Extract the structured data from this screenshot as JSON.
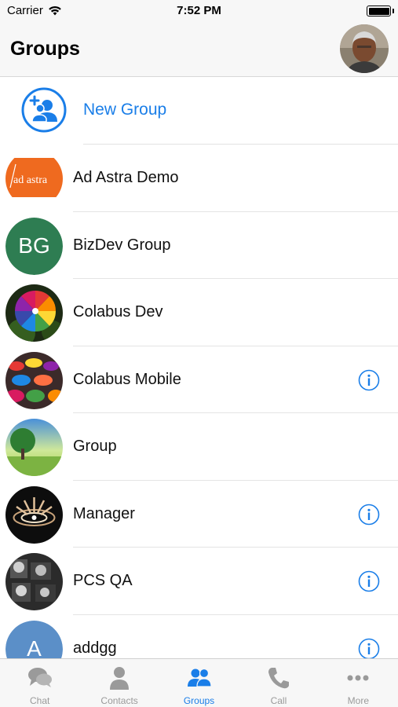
{
  "status_bar": {
    "carrier": "Carrier",
    "time": "7:52 PM"
  },
  "header": {
    "title": "Groups"
  },
  "new_group": {
    "label": "New Group"
  },
  "groups": [
    {
      "name": "Ad Astra Demo",
      "logo_text": "ad astra",
      "info": false
    },
    {
      "name": "BizDev Group",
      "initials": "BG",
      "color": "#2e7d52",
      "info": false
    },
    {
      "name": "Colabus Dev",
      "info": false
    },
    {
      "name": "Colabus Mobile",
      "info": true
    },
    {
      "name": "Group",
      "info": false
    },
    {
      "name": "Manager",
      "info": true
    },
    {
      "name": "PCS QA",
      "info": true
    },
    {
      "name": "addgg",
      "initials": "A",
      "color": "#5b8fc8",
      "info": true
    }
  ],
  "tabs": [
    {
      "label": "Chat",
      "icon": "chat-icon",
      "active": false
    },
    {
      "label": "Contacts",
      "icon": "contacts-icon",
      "active": false
    },
    {
      "label": "Groups",
      "icon": "groups-icon",
      "active": true
    },
    {
      "label": "Call",
      "icon": "call-icon",
      "active": false
    },
    {
      "label": "More",
      "icon": "more-icon",
      "active": false
    }
  ],
  "colors": {
    "accent": "#1a7ee8",
    "inactive": "#9a9a9a",
    "bar": "#f7f7f7"
  }
}
